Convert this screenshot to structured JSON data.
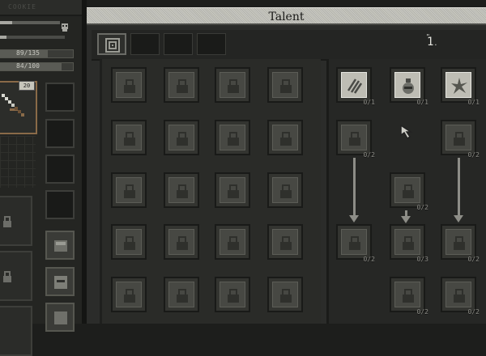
{
  "window": {
    "title": "Talent"
  },
  "left_panel": {
    "header_text": "COOKIE",
    "hp": {
      "label": "89/135",
      "fraction": 0.66
    },
    "mana": {
      "label": "84/100",
      "fraction": 0.84
    },
    "weapon": {
      "level": "20",
      "icon": "sword-icon"
    }
  },
  "talent_points": {
    "value": "1",
    "suffix": "."
  },
  "tabs": [
    {
      "icon": "target-icon",
      "active": true
    },
    {
      "icon": "",
      "active": false
    },
    {
      "icon": "",
      "active": false
    },
    {
      "icon": "",
      "active": false
    }
  ],
  "tree": {
    "row1": [
      {
        "icon": "claw-slash-icon",
        "count": "0/1"
      },
      {
        "icon": "potion-flask-icon",
        "count": "0/1"
      },
      {
        "icon": "spiky-burst-icon",
        "count": "0/1"
      }
    ],
    "row2": [
      {
        "count": "0/2"
      },
      {
        "count": "0/2"
      }
    ],
    "row3": [
      {
        "count": "0/2"
      }
    ],
    "row4": [
      {
        "count": "0/2"
      },
      {
        "count": "0/3"
      },
      {
        "count": "0/2"
      }
    ],
    "row5": [
      {
        "count": "0/2"
      },
      {
        "count": "0/2"
      }
    ]
  },
  "colors": {
    "skill_bg": "#bebdb4",
    "locked_bg": "#474843",
    "title_bar": "#c9c9c2"
  }
}
